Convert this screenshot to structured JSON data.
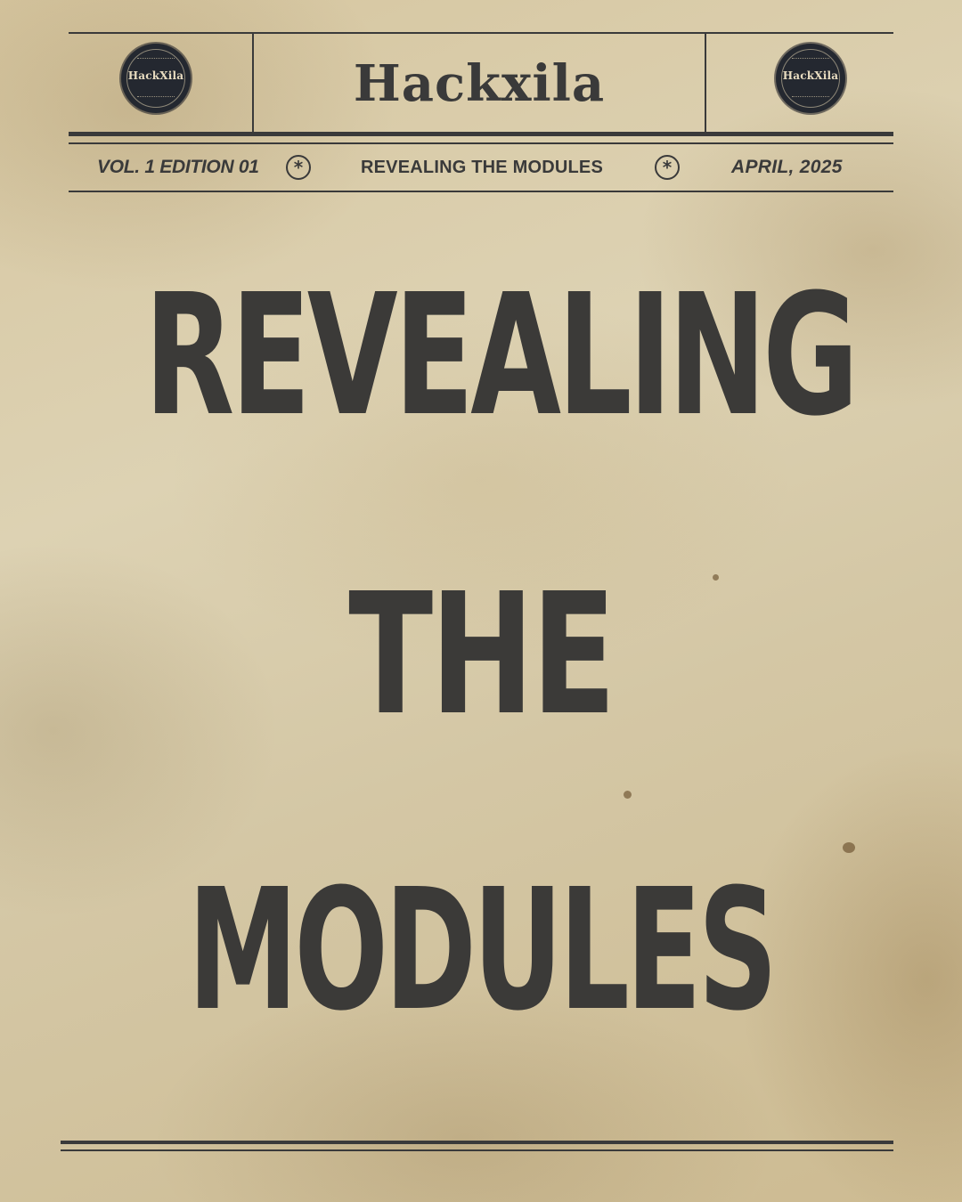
{
  "masthead": {
    "brand": "Hackxila",
    "seal_left": "HackXila",
    "seal_right": "HackXila"
  },
  "infobar": {
    "volume": "VOL. 1 EDITION 01",
    "topic": "REVEALING THE MODULES",
    "date": "APRIL, 2025",
    "separator_icon": "asterisk-circle-icon"
  },
  "headline": {
    "line1": "REVEALING",
    "line2": "THE",
    "line3": "MODULES"
  },
  "colors": {
    "ink": "#3a3a3a",
    "paper": "#d8cba9",
    "seal": "#242830"
  }
}
